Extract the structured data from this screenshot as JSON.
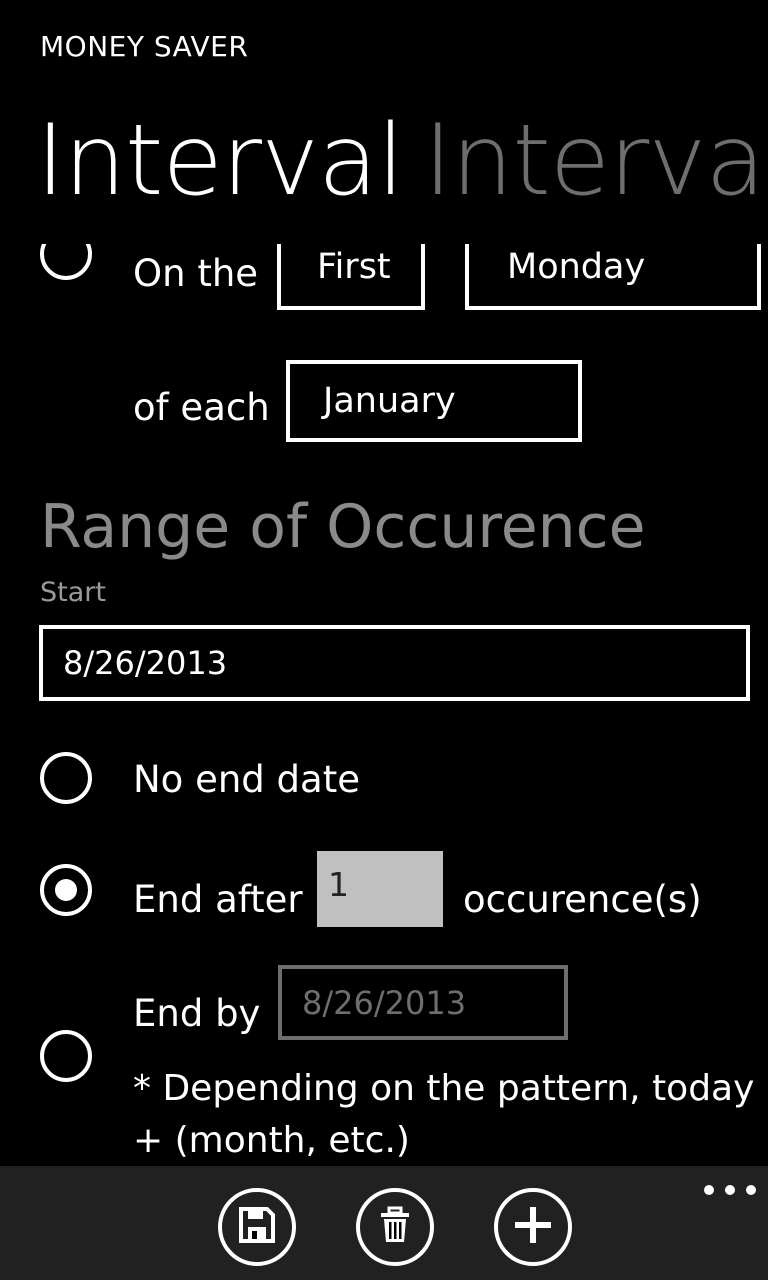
{
  "app": {
    "title": "MONEY SAVER"
  },
  "pivot": {
    "active": "Interval",
    "next": "Interval"
  },
  "monthly": {
    "on_the_label": "On the",
    "ordinal_value": "First",
    "weekday_value": "Monday",
    "of_each_label": "of each",
    "month_value": "January"
  },
  "range": {
    "title": "Range of Occurence",
    "start_label": "Start",
    "start_value": "8/26/2013",
    "no_end_label": "No end date",
    "end_after_label": "End after",
    "occurrences_value": "1",
    "occurrences_suffix": "occurence(s)",
    "end_by_label": "End by",
    "end_by_value": "8/26/2013",
    "note_line1": "* Depending on the pattern, today",
    "note_line2": "+ (month, etc.)",
    "selected_option": "end_after"
  },
  "appbar": {
    "buttons": [
      "save-icon",
      "delete-icon",
      "add-icon"
    ],
    "more": "more-icon"
  },
  "colors": {
    "background": "#000000",
    "foreground": "#ffffff",
    "subtle": "#8a8a8a",
    "appbar": "#212121",
    "input_disabled": "#c0c0c0"
  }
}
